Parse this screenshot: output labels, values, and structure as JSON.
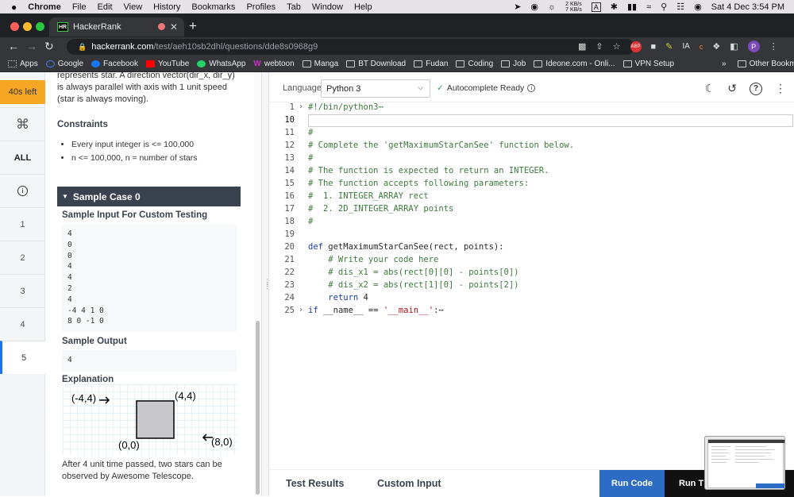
{
  "macos": {
    "app": "Chrome",
    "menus": [
      "File",
      "Edit",
      "View",
      "History",
      "Bookmarks",
      "Profiles",
      "Tab",
      "Window",
      "Help"
    ],
    "net_up": "2 KB/s",
    "net_down": "7 KB/s",
    "input_badge": "A",
    "datetime": "Sat 4 Dec  3:54 PM"
  },
  "browser": {
    "tab_title": "HackerRank",
    "tab_favicon": "HR",
    "url_host": "hackerrank.com",
    "url_path": "/test/aeh10sb2dhl/questions/dde8s0968g9",
    "profile_initial": "P",
    "bookmarks": [
      {
        "label": "Apps",
        "icon": "grid-icon"
      },
      {
        "label": "Google",
        "icon": "google-icon"
      },
      {
        "label": "Facebook",
        "icon": "facebook-icon"
      },
      {
        "label": "YouTube",
        "icon": "youtube-icon"
      },
      {
        "label": "WhatsApp",
        "icon": "whatsapp-icon"
      },
      {
        "label": "webtoon",
        "icon": "webtoon-icon"
      },
      {
        "label": "Manga",
        "icon": "folder-icon"
      },
      {
        "label": "BT Download",
        "icon": "folder-icon"
      },
      {
        "label": "Fudan",
        "icon": "folder-icon"
      },
      {
        "label": "Coding",
        "icon": "folder-icon"
      },
      {
        "label": "Job",
        "icon": "folder-icon"
      },
      {
        "label": "Ideone.com - Onli...",
        "icon": "ideone-icon"
      },
      {
        "label": "VPN Setup",
        "icon": "folder-icon"
      }
    ],
    "bookmarks_more": "»",
    "other_bookmarks": "Other Bookmarks"
  },
  "rail": {
    "timer": "40s left",
    "items": [
      "1",
      "2",
      "3",
      "4",
      "5"
    ],
    "all_label": "ALL",
    "active_index": 4
  },
  "problem": {
    "intro_line0": "represents star. A direction vector(dir_x, dir_y)",
    "intro_line1": "is always parallel with axis with 1 unit speed",
    "intro_line2": "(star is always moving).",
    "constraints_heading": "Constraints",
    "constraints": [
      "Every input integer is <= 100,000",
      "n <= 100,000, n = number of stars"
    ],
    "sample_case_title": "Sample Case 0",
    "sample_input_heading": "Sample Input For Custom Testing",
    "sample_input": [
      "4",
      "0",
      "0",
      "4",
      "4",
      "2",
      "4",
      "-4 4 1 0",
      "8 0 -1 0"
    ],
    "sample_output_heading": "Sample Output",
    "sample_output": "4",
    "explanation_heading": "Explanation",
    "figure_labels": {
      "top_left": "(-4,4)",
      "top_right": "(4,4)",
      "origin": "(0,0)",
      "right": "(8,0)"
    },
    "explanation_line0": "After 4 unit time passed, two stars can be",
    "explanation_line1": "observed by Awesome Telescope."
  },
  "editor": {
    "language_label": "Language",
    "language": "Python 3",
    "autocomplete": "Autocomplete Ready",
    "current_line": "10",
    "lines": [
      {
        "n": "1",
        "fold": "›",
        "text": "#!/bin/python3⋯",
        "cls": "com"
      },
      {
        "n": "10",
        "fold": "",
        "text": "",
        "cls": ""
      },
      {
        "n": "11",
        "fold": "",
        "text": "#",
        "cls": "com"
      },
      {
        "n": "12",
        "fold": "",
        "text": "# Complete the 'getMaximumStarCanSee' function below.",
        "cls": "com"
      },
      {
        "n": "13",
        "fold": "",
        "text": "#",
        "cls": "com"
      },
      {
        "n": "14",
        "fold": "",
        "text": "# The function is expected to return an INTEGER.",
        "cls": "com"
      },
      {
        "n": "15",
        "fold": "",
        "text": "# The function accepts following parameters:",
        "cls": "com"
      },
      {
        "n": "16",
        "fold": "",
        "text": "#  1. INTEGER_ARRAY rect",
        "cls": "com"
      },
      {
        "n": "17",
        "fold": "",
        "text": "#  2. 2D_INTEGER_ARRAY points",
        "cls": "com"
      },
      {
        "n": "18",
        "fold": "",
        "text": "#",
        "cls": "com"
      },
      {
        "n": "19",
        "fold": "",
        "text": "",
        "cls": ""
      },
      {
        "n": "20",
        "fold": "",
        "text": "def getMaximumStarCanSee(rect, points):",
        "cls": "def"
      },
      {
        "n": "21",
        "fold": "",
        "text": "    # Write your code here",
        "cls": "com"
      },
      {
        "n": "22",
        "fold": "",
        "text": "    # dis_x1 = abs(rect[0][0] - points[0])",
        "cls": "com"
      },
      {
        "n": "23",
        "fold": "",
        "text": "    # dis_x2 = abs(rect[1][0] - points[2])",
        "cls": "com"
      },
      {
        "n": "24",
        "fold": "",
        "text": "    return 4",
        "cls": "ret"
      },
      {
        "n": "25",
        "fold": "›",
        "text": "if __name__ == '__main__':⋯",
        "cls": "main"
      }
    ],
    "test_results_tab": "Test Results",
    "custom_input_tab": "Custom Input",
    "run_code": "Run Code",
    "run_tests": "Run T"
  },
  "colors": {
    "accent": "#2d6cc4",
    "timer": "#f5a623",
    "header_dark": "#39424e"
  }
}
